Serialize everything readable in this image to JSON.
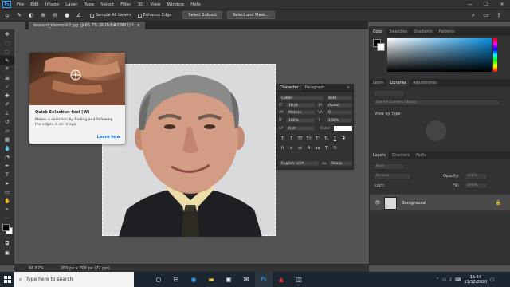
{
  "menu": {
    "logo": "Ps",
    "items": [
      "File",
      "Edit",
      "Image",
      "Layer",
      "Type",
      "Select",
      "Filter",
      "3D",
      "View",
      "Window",
      "Help"
    ],
    "window_controls": [
      "—",
      "❐",
      "✕"
    ]
  },
  "options": {
    "sample_all_layers": "Sample All Layers",
    "enhance_edge": "Enhance Edge",
    "select_subject": "Select Subject",
    "select_and_mask": "Select and Mask..."
  },
  "document": {
    "tab_title": "leonard_kleinrock2.jpg @ 66.7% (RGB/8#/CMYK) *",
    "zoom": "66.67%",
    "dimensions": "700 px x 700 px (72 ppi)"
  },
  "tooltip": {
    "title": "Quick Selection tool (W)",
    "description": "Makes a selection by finding and following the edges in an image",
    "link": "Learn how"
  },
  "character_panel": {
    "tabs": [
      "Character",
      "Paragraph"
    ],
    "font_family": "Calibri",
    "font_style": "Bold",
    "font_size": "18 pt",
    "leading": "(Auto)",
    "kerning": "Metrics",
    "tracking": "0",
    "vertical_scale": "100%",
    "horizontal_scale": "100%",
    "baseline_shift": "0 pt",
    "color_label": "Color:",
    "language": "English: USA",
    "antialias": "Sharp",
    "type_buttons": [
      "T",
      "T",
      "TT",
      "Tт",
      "T¹",
      "T₁",
      "T",
      "T"
    ]
  },
  "right_panel": {
    "color_tabs": [
      "Color",
      "Swatches",
      "Gradients",
      "Patterns"
    ],
    "library_tabs": [
      "Learn",
      "Libraries",
      "Adjustments"
    ],
    "search_placeholder": "Search Current Library",
    "view_by": "View by Type",
    "layers_tabs": [
      "Layers",
      "Channels",
      "Paths"
    ],
    "kind": "Kind",
    "blend_mode": "Normal",
    "opacity_label": "Opacity:",
    "opacity": "100%",
    "lock_label": "Lock:",
    "fill_label": "Fill:",
    "fill": "100%",
    "layer_name": "Background"
  },
  "taskbar": {
    "search_placeholder": "Type here to search",
    "time": "15:54",
    "date": "11/12/2020"
  },
  "colors": {
    "accent": "#31a8ff",
    "link": "#1473e6",
    "panel": "#323232",
    "workspace": "#535353"
  }
}
